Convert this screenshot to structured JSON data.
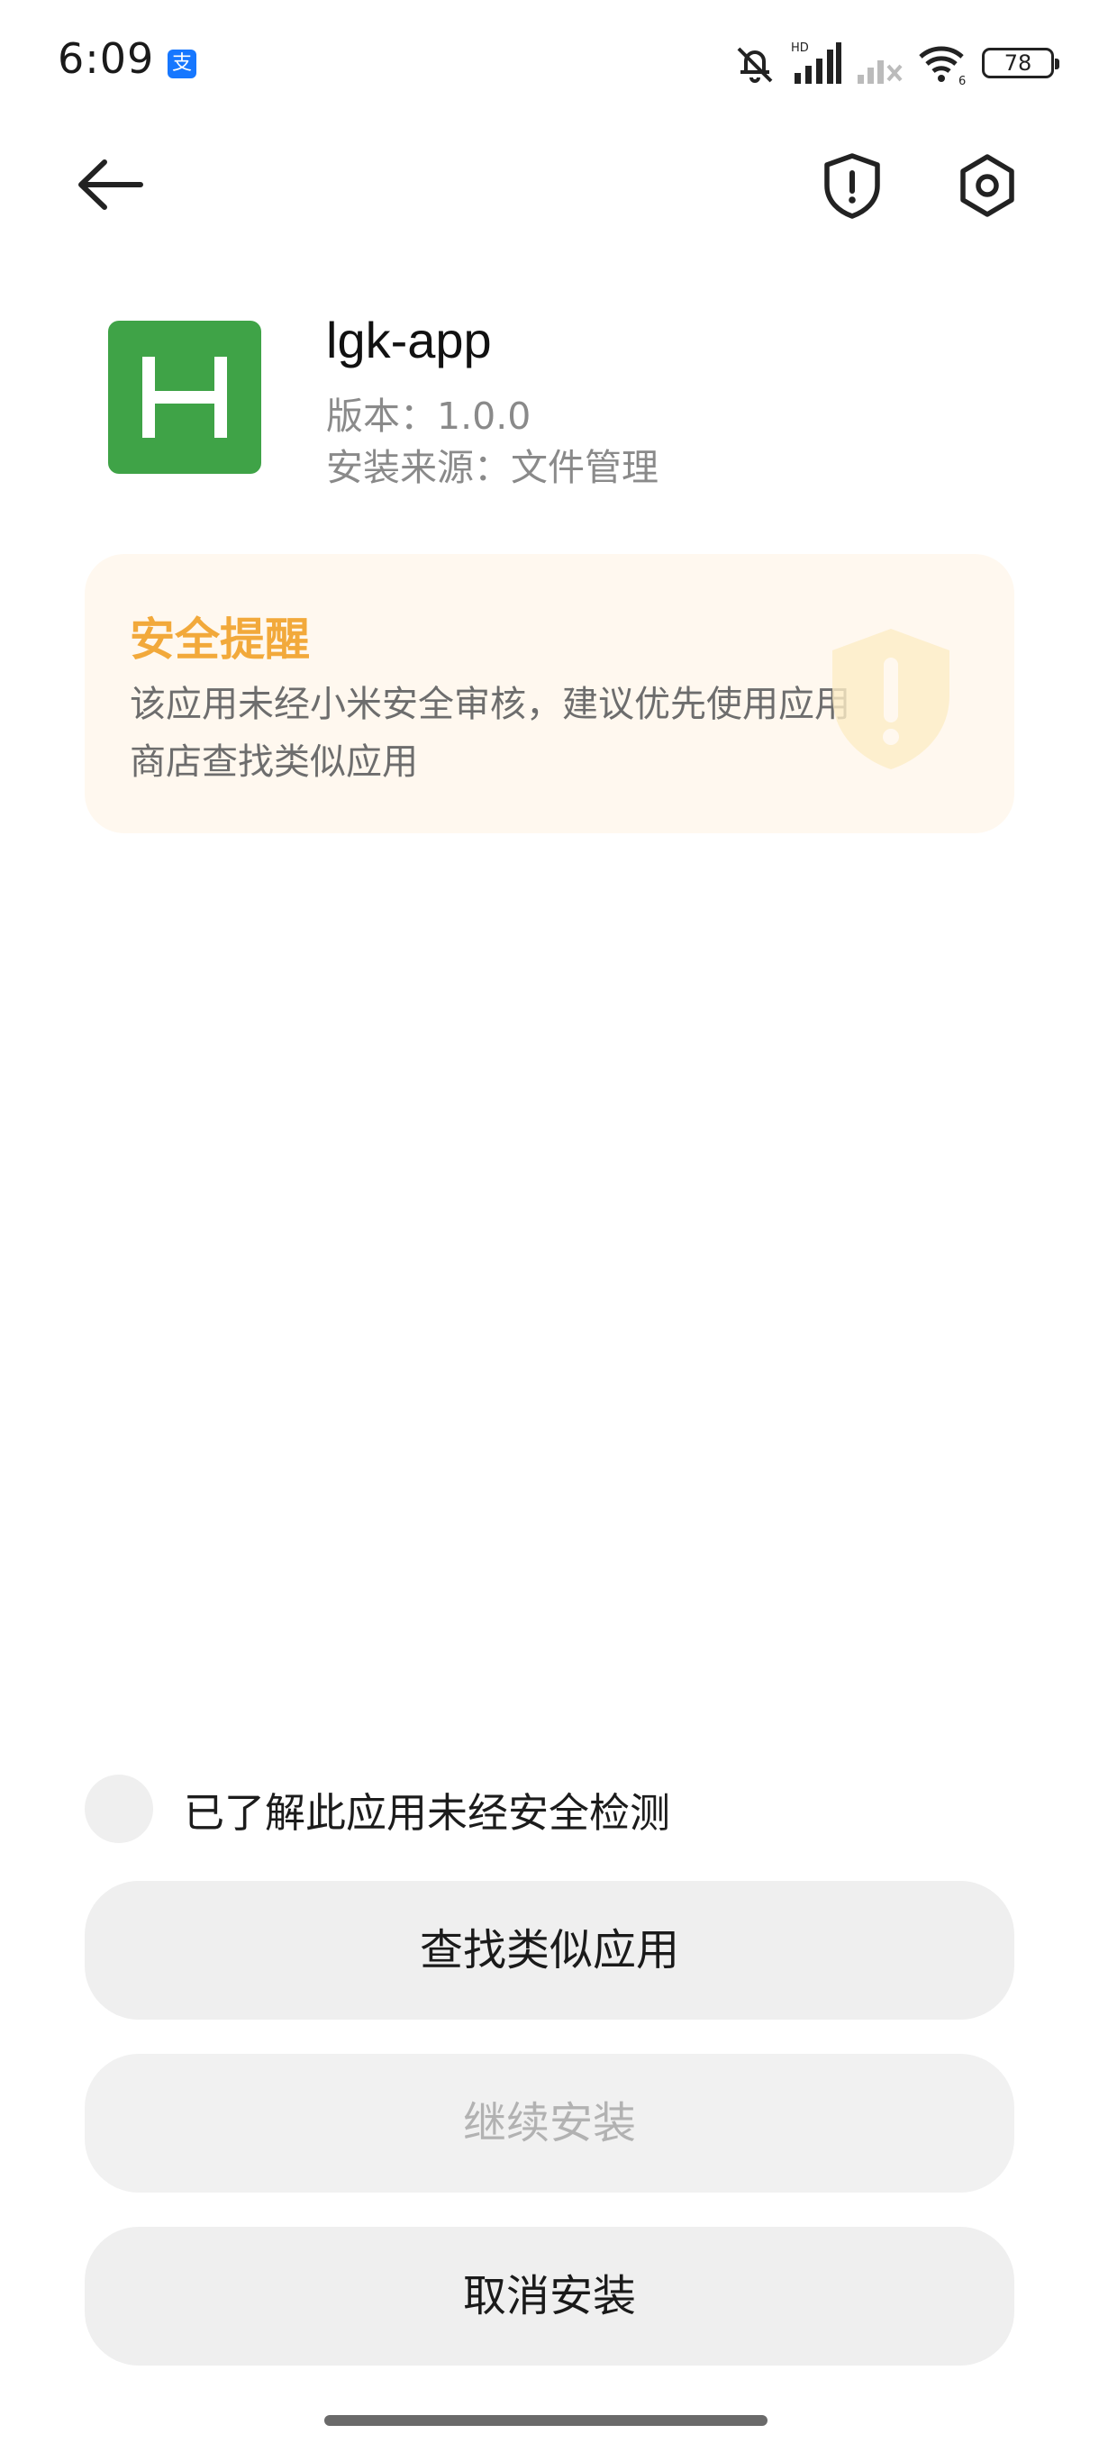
{
  "status_bar": {
    "time": "6:09",
    "alipay_glyph": "支",
    "network_hd_label": "HD",
    "wifi_label": "6",
    "battery_level": "78"
  },
  "nav": {
    "back_icon": "arrow-left-icon",
    "shield_icon": "shield-alert-icon",
    "settings_icon": "settings-gear-icon"
  },
  "app": {
    "icon_letter": "H",
    "icon_color": "#3fa347",
    "name": "lgk-app",
    "version": "版本：1.0.0",
    "source": "安装来源：文件管理"
  },
  "warning": {
    "title": "安全提醒",
    "body": "该应用未经小米安全审核，建议优先使用应用商店查找类似应用",
    "accent_color": "#f2a93b"
  },
  "acknowledge": {
    "label": "已了解此应用未经安全检测",
    "checked": false
  },
  "buttons": {
    "find_similar": "查找类似应用",
    "continue_install": "继续安装",
    "cancel_install": "取消安装"
  }
}
